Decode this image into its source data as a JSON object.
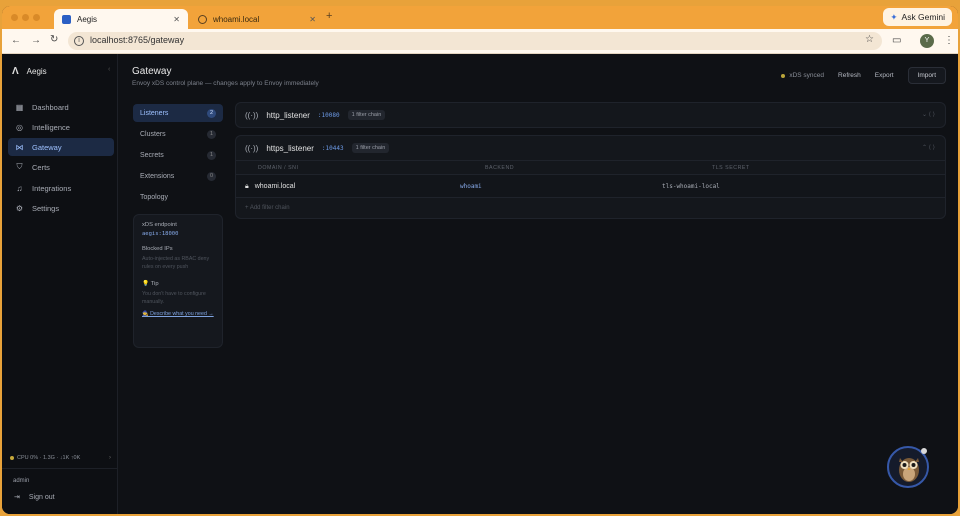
{
  "browser": {
    "tabs": [
      {
        "title": "Aegis",
        "active": true
      },
      {
        "title": "whoami.local",
        "active": false
      }
    ],
    "new_tab": "+",
    "ask_gemini": "Ask Gemini",
    "url": "localhost:8765/gateway",
    "profile_initial": "Y"
  },
  "sidebar": {
    "brand": "Aegis",
    "collapse": "‹",
    "items": [
      {
        "label": "Dashboard",
        "icon": "grid-icon",
        "active": false
      },
      {
        "label": "Intelligence",
        "icon": "compass-icon",
        "active": false
      },
      {
        "label": "Gateway",
        "icon": "nodes-icon",
        "active": true
      },
      {
        "label": "Certs",
        "icon": "shield-icon",
        "active": false
      },
      {
        "label": "Integrations",
        "icon": "bell-icon",
        "active": false
      },
      {
        "label": "Settings",
        "icon": "gear-icon",
        "active": false
      }
    ],
    "status": "CPU 0% · 1.3G · ↓1K ↑0K",
    "status_more": "›",
    "user": "admin",
    "signout": "Sign out"
  },
  "header": {
    "title": "Gateway",
    "subtitle": "Envoy xDS control plane — changes apply to Envoy immediately",
    "sync_status": "xDS synced",
    "refresh": "Refresh",
    "export": "Export",
    "import": "Import"
  },
  "subnav": {
    "items": [
      {
        "label": "Listeners",
        "count": "2",
        "active": true
      },
      {
        "label": "Clusters",
        "count": "1",
        "active": false
      },
      {
        "label": "Secrets",
        "count": "1",
        "active": false
      },
      {
        "label": "Extensions",
        "count": "0",
        "active": false
      },
      {
        "label": "Topology",
        "count": "",
        "active": false
      }
    ]
  },
  "infocard": {
    "endpoint_label": "xDS endpoint",
    "endpoint_value": "aegis:18000",
    "blocked_label": "Blocked IPs",
    "blocked_desc": "Auto-injected as RBAC deny rules on every push",
    "tip_label": "💡 Tip",
    "tip_text": "You don't have to configure manually.",
    "tip_link": "🧙 Describe what you need →"
  },
  "listeners": [
    {
      "name": "http_listener",
      "port": ":10080",
      "chains": "1 filter chain",
      "controls": "⌄   ⟨ ⟩",
      "expanded": false
    },
    {
      "name": "https_listener",
      "port": ":10443",
      "chains": "1 filter chain",
      "controls": "⌃   ⟨ ⟩",
      "expanded": true,
      "columns": [
        "DOMAIN / SNI",
        "BACKEND",
        "TLS SECRET"
      ],
      "rows": [
        {
          "domain": "whoami.local",
          "backend": "whoami",
          "secret": "tls-whoami-local"
        }
      ],
      "add_label": "+ Add filter chain"
    }
  ]
}
